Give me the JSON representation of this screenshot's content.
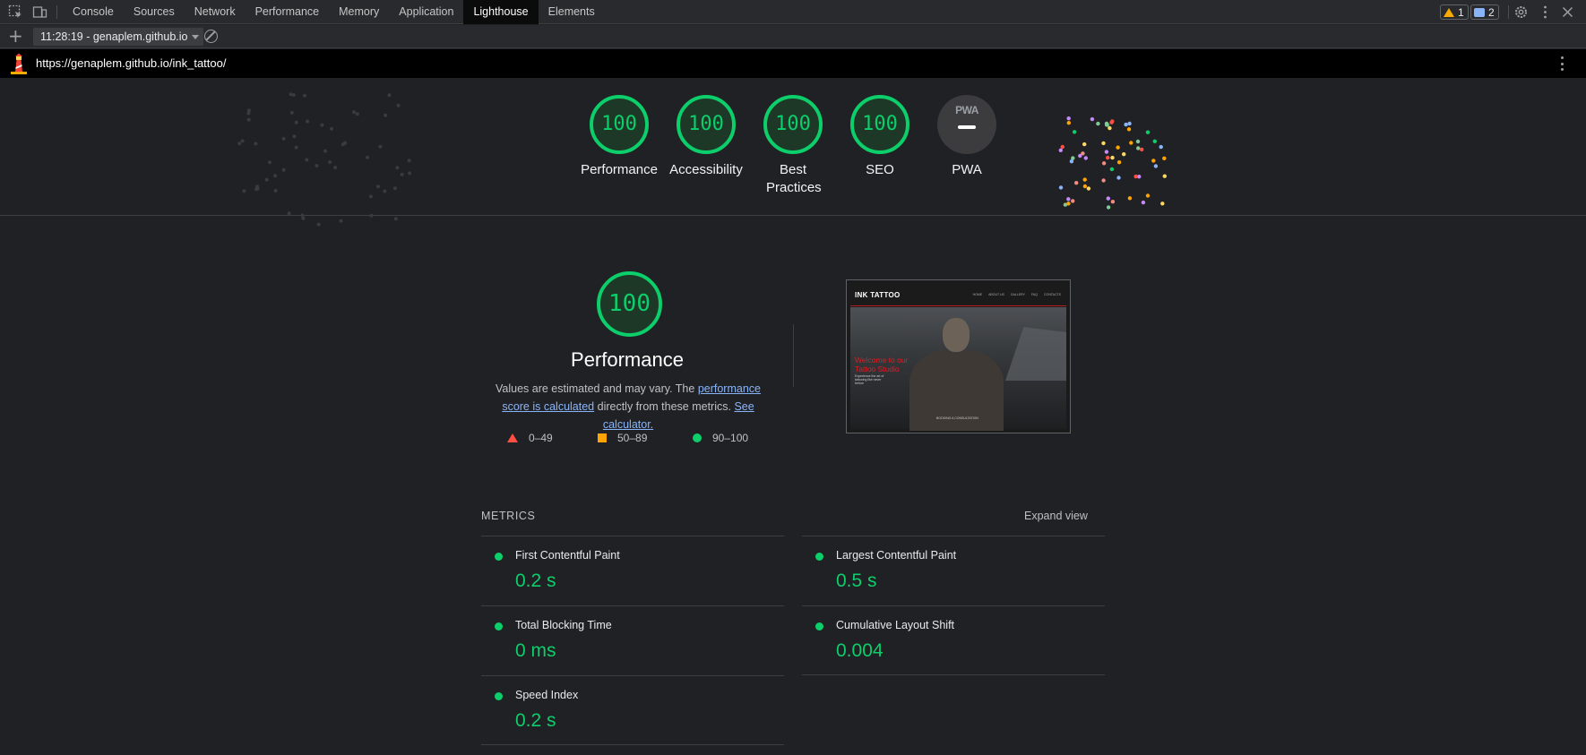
{
  "devtools": {
    "tabs": [
      "Console",
      "Sources",
      "Network",
      "Performance",
      "Memory",
      "Application",
      "Lighthouse",
      "Elements"
    ],
    "active_tab": "Lighthouse",
    "warnings_count": "1",
    "messages_count": "2"
  },
  "toolbar": {
    "report_select": "11:28:19 - genaplem.github.io"
  },
  "report": {
    "url": "https://genaplem.github.io/ink_tattoo/"
  },
  "scores": [
    {
      "label": "Performance",
      "value": "100"
    },
    {
      "label": "Accessibility",
      "value": "100"
    },
    {
      "label": "Best Practices",
      "value": "100"
    },
    {
      "label": "SEO",
      "value": "100"
    },
    {
      "label": "PWA",
      "value": "PWA"
    }
  ],
  "performance": {
    "score": "100",
    "title": "Performance",
    "desc_prefix": "Values are estimated and may vary. The ",
    "desc_link1": "performance score is calculated",
    "desc_middle": " directly from these metrics. ",
    "desc_link2": "See calculator.",
    "legend": {
      "fail": "0–49",
      "average": "50–89",
      "pass": "90–100"
    }
  },
  "screenshot": {
    "brand": "INK TATTOO",
    "nav": [
      "HOME",
      "ABOUT US",
      "GALLERY",
      "FAQ",
      "CONTACTS"
    ],
    "headline_line1": "Welcome to our",
    "headline_line2": "Tattoo Studio",
    "subtext": "Experience the art of tattooing like never before",
    "cta": "BOOKING A CONSULTATION"
  },
  "metrics": {
    "section_label": "METRICS",
    "expand_label": "Expand view",
    "items": [
      {
        "title": "First Contentful Paint",
        "value": "0.2 s"
      },
      {
        "title": "Largest Contentful Paint",
        "value": "0.5 s"
      },
      {
        "title": "Total Blocking Time",
        "value": "0 ms"
      },
      {
        "title": "Cumulative Layout Shift",
        "value": "0.004"
      },
      {
        "title": "Speed Index",
        "value": "0.2 s"
      }
    ]
  },
  "colors": {
    "pass": "#0cce6b",
    "average": "#ffa400",
    "fail": "#ff4e42",
    "link": "#8ab4f8",
    "background": "#202124"
  }
}
